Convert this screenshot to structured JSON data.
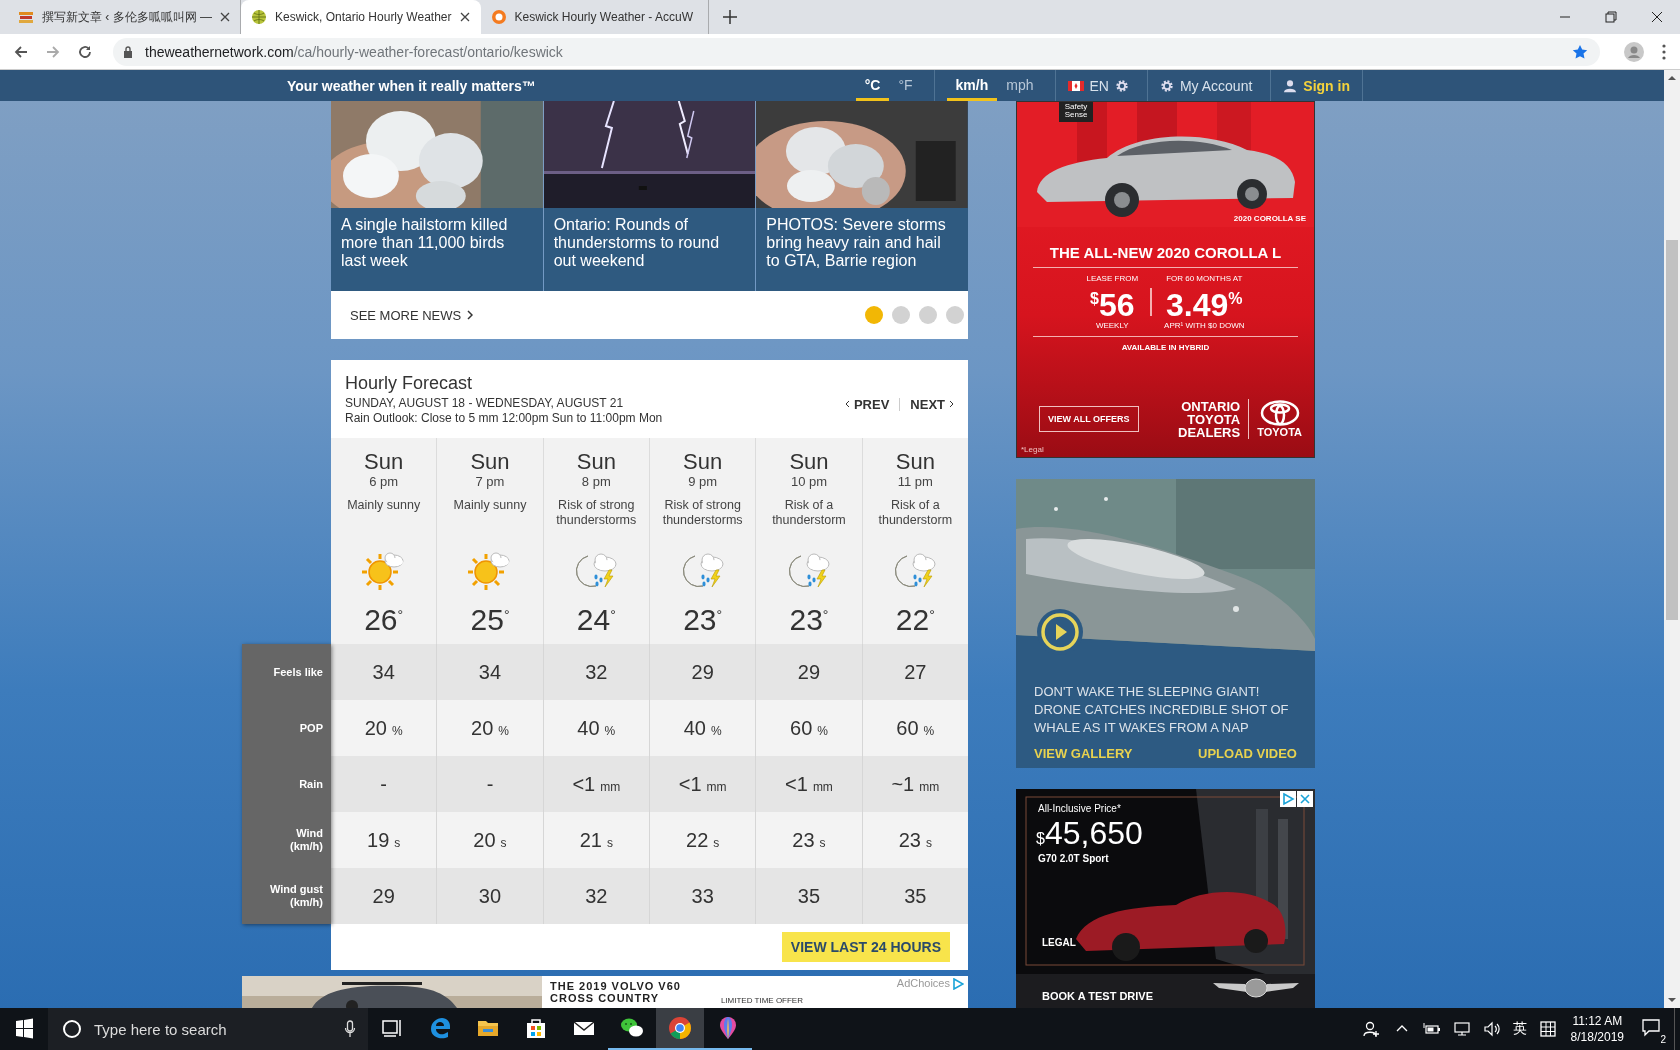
{
  "browser": {
    "tabs": [
      {
        "title": "撰写新文章 ‹ 多伦多呱呱叫网 —",
        "kind": "books",
        "selected": false,
        "closable": true
      },
      {
        "title": "Keswick, Ontario Hourly Weather",
        "kind": "globe",
        "selected": true,
        "closable": true
      },
      {
        "title": "Keswick Hourly Weather - AccuW",
        "kind": "sun",
        "selected": false,
        "closable": false
      }
    ],
    "address": {
      "domain": "theweathernetwork.com",
      "path": "/ca/hourly-weather-forecast/ontario/keswick"
    }
  },
  "site_header": {
    "tagline": "Your weather when it really matters™",
    "temp_units": [
      {
        "label": "°C",
        "selected": true
      },
      {
        "label": "°F",
        "selected": false
      }
    ],
    "speed_units": [
      {
        "label": "km/h",
        "selected": true
      },
      {
        "label": "mph",
        "selected": false
      }
    ],
    "language": "EN",
    "account": "My Account",
    "sign_in": "Sign in"
  },
  "news": {
    "cards": [
      {
        "caption": "A single hailstorm killed more than 11,000 birds last week"
      },
      {
        "caption": "Ontario: Rounds of thunderstorms to round out weekend"
      },
      {
        "caption": "PHOTOS: Severe storms bring heavy rain and hail to GTA, Barrie region"
      }
    ],
    "see_more": "SEE MORE NEWS",
    "dots": [
      {
        "selected": true
      },
      {
        "selected": false
      },
      {
        "selected": false
      },
      {
        "selected": false
      }
    ]
  },
  "forecast": {
    "title": "Hourly Forecast",
    "dates": "SUNDAY, AUGUST 18 - WEDNESDAY, AUGUST 21",
    "rain_outlook": "Rain Outlook: Close to 5 mm 12:00pm Sun to 11:00pm Mon",
    "prev": "PREV",
    "next": "NEXT",
    "hours": [
      {
        "day": "Sun",
        "time": "6 pm",
        "condition": "Mainly sunny",
        "kind": "sun_cloud",
        "temp": "26$^{°}$"
      },
      {
        "day": "Sun",
        "time": "7 pm",
        "condition": "Mainly sunny",
        "kind": "sun_cloud",
        "temp": "25$^{°}$"
      },
      {
        "day": "Sun",
        "time": "8 pm",
        "condition": "Risk of strong thunderstorms",
        "kind": "moon_storm",
        "temp": "24$^{°}$"
      },
      {
        "day": "Sun",
        "time": "9 pm",
        "condition": "Risk of strong thunderstorms",
        "kind": "moon_storm",
        "temp": "23$^{°}$"
      },
      {
        "day": "Sun",
        "time": "10 pm",
        "condition": "Risk of a thunderstorm",
        "kind": "moon_storm",
        "temp": "23$^{°}$"
      },
      {
        "day": "Sun",
        "time": "11 pm",
        "condition": "Risk of a thunderstorm",
        "kind": "moon_storm",
        "temp": "22$^{°}$"
      }
    ],
    "rows": [
      {
        "label": "Feels like",
        "values": [
          {
            "value": "34"
          },
          {
            "value": "34"
          },
          {
            "value": "32"
          },
          {
            "value": "29"
          },
          {
            "value": "29"
          },
          {
            "value": "27"
          }
        ]
      },
      {
        "label": "POP",
        "values": [
          {
            "value": "20",
            "unit": "%"
          },
          {
            "value": "20",
            "unit": "%"
          },
          {
            "value": "40",
            "unit": "%"
          },
          {
            "value": "40",
            "unit": "%"
          },
          {
            "value": "60",
            "unit": "%"
          },
          {
            "value": "60",
            "unit": "%"
          }
        ]
      },
      {
        "label": "Rain",
        "values": [
          {
            "value": "-"
          },
          {
            "value": "-"
          },
          {
            "value": "<1",
            "unit": "mm"
          },
          {
            "value": "<1",
            "unit": "mm"
          },
          {
            "value": "<1",
            "unit": "mm"
          },
          {
            "value": "~1",
            "unit": "mm"
          }
        ]
      },
      {
        "label": "Wind\n(km/h)",
        "values": [
          {
            "value": "19",
            "unit": "s"
          },
          {
            "value": "20",
            "unit": "s"
          },
          {
            "value": "21",
            "unit": "s"
          },
          {
            "value": "22",
            "unit": "s"
          },
          {
            "value": "23",
            "unit": "s"
          },
          {
            "value": "23",
            "unit": "s"
          }
        ]
      },
      {
        "label": "Wind gust\n(km/h)",
        "values": [
          {
            "value": "29"
          },
          {
            "value": "30"
          },
          {
            "value": "32"
          },
          {
            "value": "33"
          },
          {
            "value": "35"
          },
          {
            "value": "35"
          }
        ]
      }
    ],
    "view_last": "VIEW LAST 24 HOURS"
  },
  "toyota_ad": {
    "badge": "Safety Sense",
    "model": "2020 COROLLA SE",
    "headline": "THE ALL-NEW 2020 COROLLA L",
    "lease_label": "LEASE FROM",
    "currency": "$",
    "amount": "56",
    "period": "WEEKLY",
    "term": "FOR 60 MONTHS AT",
    "rate": "3.49",
    "percent": "%",
    "apr": "APR¹ WITH $0 DOWN",
    "hybrid": "AVAILABLE IN HYBRID",
    "offers": "VIEW ALL OFFERS",
    "dealer": "ONTARIO\nTOYOTA\nDEALERS",
    "brand": "TOYOTA",
    "legal": "*Legal"
  },
  "video_card": {
    "title": "DON'T WAKE THE SLEEPING GIANT! DRONE CATCHES INCREDIBLE SHOT OF WHALE AS IT WAKES FROM A NAP",
    "gallery": "VIEW GALLERY",
    "upload": "UPLOAD VIDEO"
  },
  "genesis_ad": {
    "price_label": "All-Inclusive Price*",
    "currency": "$",
    "price": "45,650",
    "model": "G70 2.0T Sport",
    "legal": "LEGAL",
    "cta": "BOOK A TEST DRIVE"
  },
  "volvo_ad": {
    "title": "THE 2019 VOLVO V60",
    "subtitle": "CROSS COUNTRY",
    "offer": "LIMITED TIME OFFER",
    "adchoices": "AdChoices"
  },
  "taskbar": {
    "search_placeholder": "Type here to search",
    "apps": [
      {
        "kind": "task_view",
        "running": false,
        "selected": false
      },
      {
        "kind": "edge",
        "running": false,
        "selected": false
      },
      {
        "kind": "folder",
        "running": false,
        "selected": false
      },
      {
        "kind": "store",
        "running": false,
        "selected": false
      },
      {
        "kind": "mail",
        "running": false,
        "selected": false
      },
      {
        "kind": "wechat",
        "running": true,
        "selected": false
      },
      {
        "kind": "chrome",
        "running": true,
        "selected": true
      },
      {
        "kind": "paint",
        "running": true,
        "selected": false
      }
    ],
    "ime": "英",
    "time": "11:12 AM",
    "date": "8/18/2019",
    "notifications": "2"
  }
}
